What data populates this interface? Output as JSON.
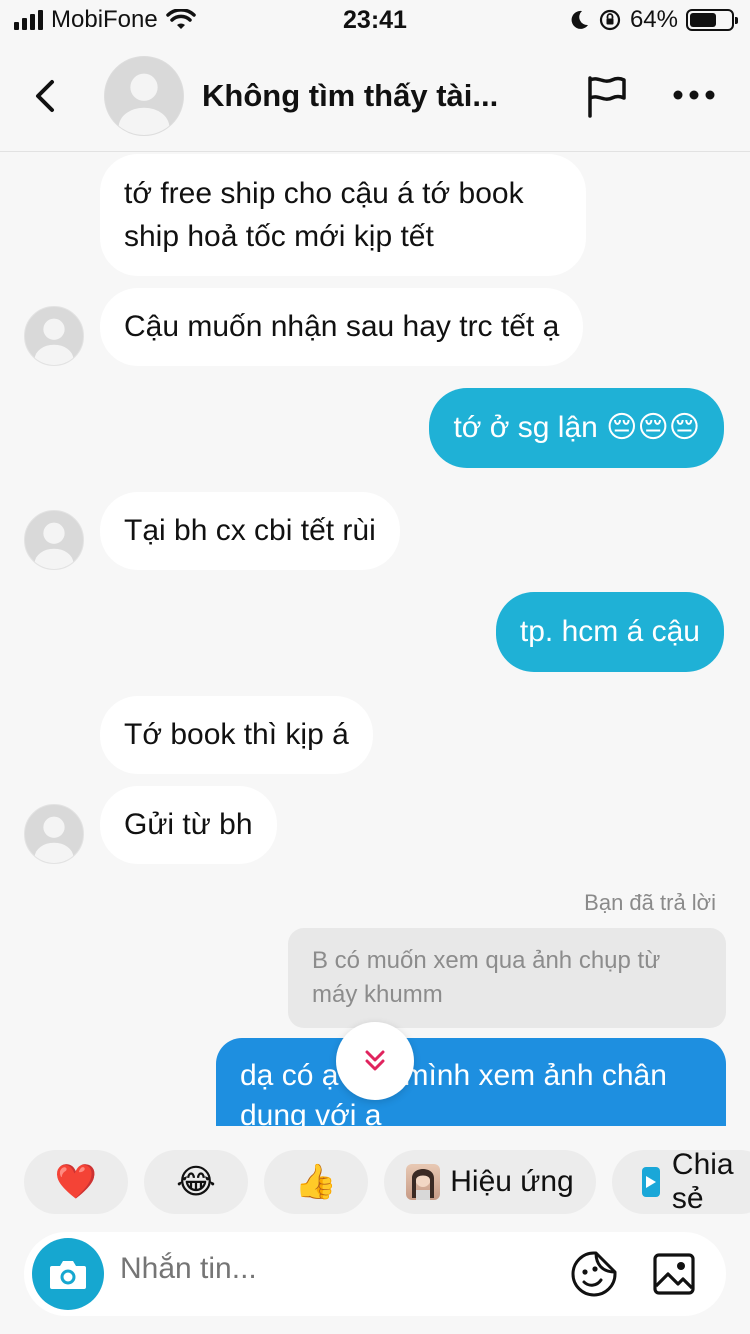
{
  "status_bar": {
    "carrier": "MobiFone",
    "time": "23:41",
    "battery": "64%",
    "battery_level": 0.64
  },
  "header": {
    "title": "Không tìm thấy tài..."
  },
  "messages": [
    {
      "side": "in",
      "text_line1": "tớ free ship cho cậu á tớ book",
      "text_line2": "ship hoả tốc mới kịp tết"
    },
    {
      "side": "in",
      "text": "Cậu muốn nhận sau hay trc tết ạ"
    },
    {
      "side": "out",
      "text": "tớ ở sg lận 😔😔😔"
    },
    {
      "side": "in",
      "text": "Tại bh cx cbi tết rùi"
    },
    {
      "side": "out",
      "text": "tp. hcm á cậu"
    },
    {
      "side": "in",
      "text": "Tớ book thì kịp á"
    },
    {
      "side": "in",
      "text": "Gửi từ bh"
    }
  ],
  "reply": {
    "label": "Bạn đã trả lời",
    "quoted_line1": "B có muốn xem qua ảnh chụp từ",
    "quoted_line2": "máy khumm",
    "text_line1": "dạ có ạ cho mình xem ảnh chân",
    "text_line2": "dung với ạ"
  },
  "quick_actions": {
    "heart": "❤️",
    "laugh": "😂",
    "thumbs": "👍",
    "effects_label": "Hiệu ứng",
    "share_label": "Chia sẻ"
  },
  "composer": {
    "placeholder": "Nhắn tin..."
  },
  "colors": {
    "outgoing": "#1fb1d6",
    "outgoing_reply": "#1e8fe0",
    "incoming": "#ffffff",
    "background": "#f7f7f7"
  }
}
